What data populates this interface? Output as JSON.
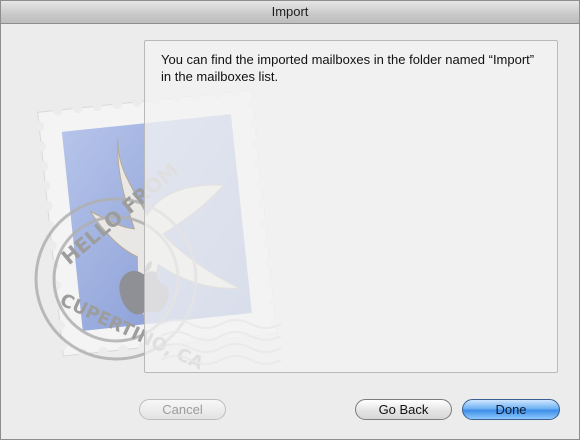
{
  "window": {
    "title": "Import"
  },
  "message": {
    "text": "You can find the imported mailboxes in the folder named “Import” in the mailboxes list."
  },
  "stamp": {
    "postmark_text_top": "HELLO FROM",
    "postmark_text_bottom": "CUPERTINO, CA",
    "icon": "mail-stamp-icon"
  },
  "buttons": {
    "cancel_label": "Cancel",
    "back_label": "Go Back",
    "done_label": "Done"
  },
  "colors": {
    "accent": "#4a95e8",
    "stamp_blue": "#8ea4d8"
  }
}
